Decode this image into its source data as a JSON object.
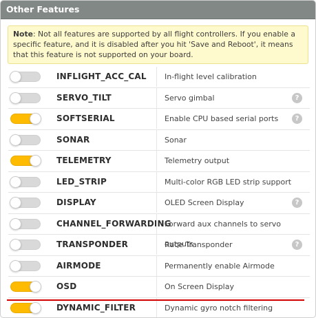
{
  "panel": {
    "title": "Other Features"
  },
  "note": {
    "label": "Note",
    "text": ": Not all features are supported by all flight controllers. If you enable a specific feature, and it is disabled after you hit 'Save and Reboot', it means that this feature is not supported on your board."
  },
  "features": [
    {
      "name": "INFLIGHT_ACC_CAL",
      "description": "In-flight level calibration",
      "enabled": false,
      "help": false
    },
    {
      "name": "SERVO_TILT",
      "description": "Servo gimbal",
      "enabled": false,
      "help": true
    },
    {
      "name": "SOFTSERIAL",
      "description": "Enable CPU based serial ports",
      "enabled": true,
      "help": true
    },
    {
      "name": "SONAR",
      "description": "Sonar",
      "enabled": false,
      "help": false
    },
    {
      "name": "TELEMETRY",
      "description": "Telemetry output",
      "enabled": true,
      "help": false
    },
    {
      "name": "LED_STRIP",
      "description": "Multi-color RGB LED strip support",
      "enabled": false,
      "help": false
    },
    {
      "name": "DISPLAY",
      "description": "OLED Screen Display",
      "enabled": false,
      "help": true
    },
    {
      "name": "CHANNEL_FORWARDING",
      "description": "Forward aux channels to servo outputs",
      "enabled": false,
      "help": false
    },
    {
      "name": "TRANSPONDER",
      "description": "Race Transponder",
      "enabled": false,
      "help": true
    },
    {
      "name": "AIRMODE",
      "description": "Permanently enable Airmode",
      "enabled": false,
      "help": false
    },
    {
      "name": "OSD",
      "description": "On Screen Display",
      "enabled": true,
      "help": false
    },
    {
      "name": "DYNAMIC_FILTER",
      "description": "Dynamic gyro notch filtering",
      "enabled": true,
      "help": false
    }
  ],
  "help_glyph": "?",
  "icons": {
    "help": "question-circle-icon"
  },
  "colors": {
    "header_bg": "#828885",
    "toggle_on": "#ffbb00",
    "toggle_off": "#d9d9d9",
    "note_bg": "#fffacd",
    "strike": "#d40000"
  }
}
